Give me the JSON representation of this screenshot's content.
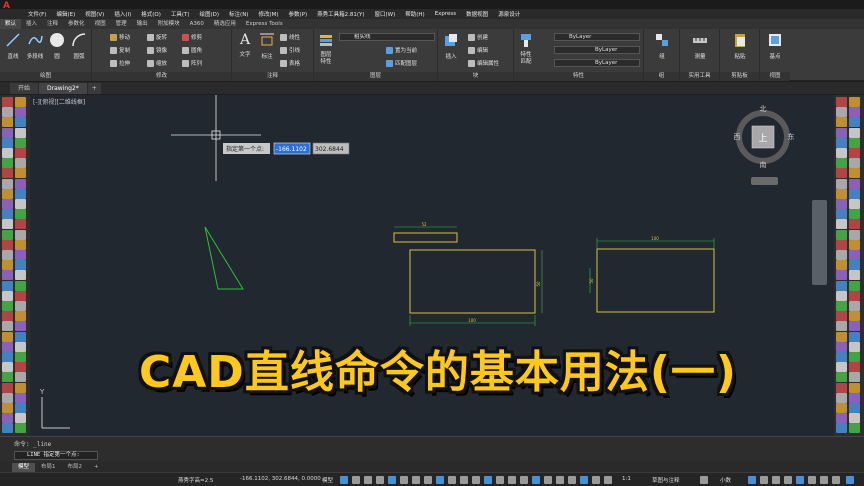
{
  "menubar": {
    "items": [
      "文件(F)",
      "编辑(E)",
      "视图(V)",
      "插入(I)",
      "格式(O)",
      "工具(T)",
      "绘图(D)",
      "标注(N)",
      "修改(M)",
      "参数(P)",
      "燕秀工具箱2.81(Y)",
      "窗口(W)",
      "帮助(H)",
      "Express",
      "数据视图",
      "源泉设计"
    ]
  },
  "ribbon_tabs": [
    "默认",
    "插入",
    "注释",
    "参数化",
    "视图",
    "管理",
    "输出",
    "附加模块",
    "A360",
    "精选应用",
    "Express Tools"
  ],
  "ribbon": {
    "draw": {
      "title": "绘图",
      "line": "直线",
      "pline": "多段线",
      "circle": "圆",
      "arc": "圆弧"
    },
    "modify": {
      "title": "修改",
      "rows": [
        [
          "移动",
          "旋转",
          "修剪"
        ],
        [
          "复制",
          "镜像",
          "圆角"
        ],
        [
          "拉伸",
          "缩放",
          "阵列"
        ]
      ]
    },
    "annotation": {
      "title": "注释",
      "text": "文字",
      "dim": "标注",
      "rows": [
        "线性",
        "引线",
        "表格"
      ]
    },
    "layers": {
      "title": "图层",
      "props": "图层\n特性",
      "current_layer": "粗实线",
      "rows": [
        "置为当前",
        "匹配图层"
      ]
    },
    "block": {
      "title": "块",
      "insert": "插入",
      "rows": [
        "创建",
        "编辑",
        "编辑属性"
      ]
    },
    "properties": {
      "title": "特性",
      "match": "特性\n匹配",
      "bylayer1": "ByLayer",
      "bylayer2": "ByLayer",
      "bylayer3": "ByLayer"
    },
    "groups": {
      "title": "组",
      "label": "组"
    },
    "utilities": {
      "title": "实用工具",
      "label": "测量"
    },
    "clipboard": {
      "title": "剪贴板",
      "label": "粘贴"
    },
    "view": {
      "title": "视图",
      "label": "基点"
    }
  },
  "doc_tabs": [
    "开始",
    "Drawing2*"
  ],
  "viewport_label": "[-][俯视][二维线框]",
  "cursor_input": {
    "prompt": "指定第一个点:",
    "x_value": "-166.1102",
    "y_value": "302.6844"
  },
  "viewcube": {
    "north": "北",
    "south": "南",
    "east": "东",
    "west": "西",
    "top": "上"
  },
  "ucs": {
    "y_label": "Y"
  },
  "drawing": {
    "dim_small_rect": "52",
    "dim_rect1_bottom": "100",
    "dim_rect1_right": "50",
    "dim_rect2_top": "100",
    "dim_rect2_left": "50"
  },
  "command": {
    "history": "命令: _line",
    "prompt": "LINE 指定第一个点:"
  },
  "layout_tabs": [
    "模型",
    "布局1",
    "布局2"
  ],
  "status": {
    "text_height": "燕秀字高=2.5",
    "coords": "-166.1102, 302.6844, 0.0000",
    "model": "模型",
    "scale": "1:1",
    "workspace": "草图与注释",
    "units": "小数"
  },
  "overlay_title": "CAD直线命令的基本用法(一)",
  "colors": {
    "canvas": "#212830",
    "ribbon": "#3b3b3b",
    "drawing_green": "#2fbf3a",
    "drawing_yellow": "#d8c040",
    "title_yellow": "#ffc81e"
  }
}
